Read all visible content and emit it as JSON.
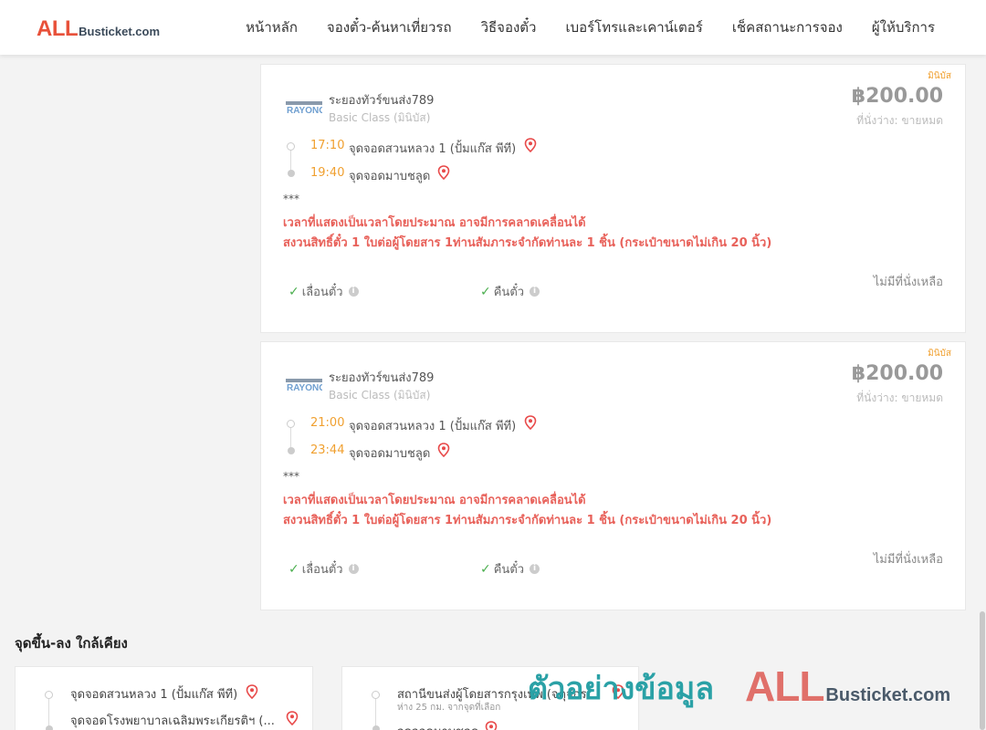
{
  "header": {
    "logo_all": "ALL",
    "logo_rest": "Busticket.com",
    "nav": [
      "หน้าหลัก",
      "จองตั๋ว-ค้นหาเที่ยวรถ",
      "วิธีจองตั๋ว",
      "เบอร์โทรและเคาน์เตอร์",
      "เช็คสถานะการจอง",
      "ผู้ให้บริการ"
    ]
  },
  "tickets": [
    {
      "badge": "มินิบัส",
      "operator": "ระยองทัวร์ขนส่ง789",
      "logo_text": "RAYONG",
      "class": "Basic Class (มินิบัส)",
      "price": "฿200.00",
      "seats": "ที่นั่งว่าง: ขายหมด",
      "depart_time": "17:10",
      "depart_stop": "จุดจอดสวนหลวง 1 (ปั้มแก๊ส พีที)",
      "arrive_time": "19:40",
      "arrive_stop": "จุดจอดมาบชลูด",
      "stars": "***",
      "note1": "เวลาที่แสดงเป็นเวลาโดยประมาณ อาจมีการคลาดเคลื่อนได้",
      "note2": "สงวนสิทธิ์ตั๋ว 1 ใบต่อผู้โดยสาร 1ท่านสัมภาระจำกัดท่านละ 1 ชิ้น (กระเป๋าขนาดไม่เกิน 20 นิ้ว)",
      "feature1": "เลื่อนตั๋ว",
      "feature2": "คืนตั๋ว",
      "status": "ไม่มีที่นั่งเหลือ"
    },
    {
      "badge": "มินิบัส",
      "operator": "ระยองทัวร์ขนส่ง789",
      "logo_text": "RAYONG",
      "class": "Basic Class (มินิบัส)",
      "price": "฿200.00",
      "seats": "ที่นั่งว่าง: ขายหมด",
      "depart_time": "21:00",
      "depart_stop": "จุดจอดสวนหลวง 1 (ปั้มแก๊ส พีที)",
      "arrive_time": "23:44",
      "arrive_stop": "จุดจอดมาบชลูด",
      "stars": "***",
      "note1": "เวลาที่แสดงเป็นเวลาโดยประมาณ อาจมีการคลาดเคลื่อนได้",
      "note2": "สงวนสิทธิ์ตั๋ว 1 ใบต่อผู้โดยสาร 1ท่านสัมภาระจำกัดท่านละ 1 ชิ้น (กระเป๋าขนาดไม่เกิน 20 นิ้ว)",
      "feature1": "เลื่อนตั๋ว",
      "feature2": "คืนตั๋ว",
      "status": "ไม่มีที่นั่งเหลือ"
    }
  ],
  "nearby": {
    "title": "จุดขึ้น-ลง ใกล้เคียง",
    "card1": {
      "stop1": "จุดจอดสวนหลวง 1 (ปั้มแก๊ส พีที)",
      "stop2": "จุดจอดโรงพยาบาลเฉลิมพระเกียรติฯ (..."
    },
    "card2": {
      "stop1": "สถานีขนส่งผู้โดยสารกรุงเทพ (จตุจักร...",
      "stop1_sub": "ห่าง 25 กม. จากจุดที่เลือก",
      "stop2": "จุดจอดมาบชลูด"
    }
  },
  "watermark": {
    "thai": "ตัวอย่างข้อมูล",
    "all": "ALL",
    "rest": "Busticket.com"
  },
  "colors": {
    "accent_orange": "#f0a030",
    "note_red": "#e8615a",
    "pin_red": "#e84a4a",
    "check_green": "#4caf50",
    "watermark_teal": "#2aa1a6"
  }
}
